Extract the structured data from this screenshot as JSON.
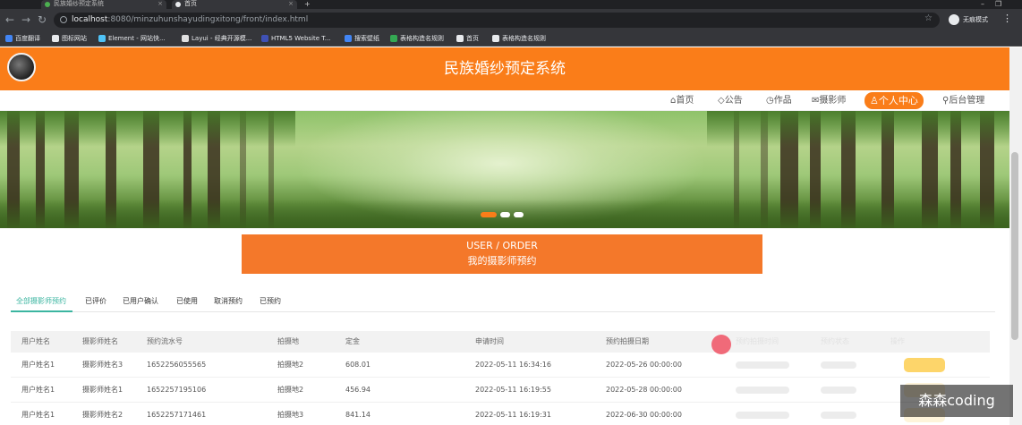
{
  "browser": {
    "tabs": [
      {
        "label": "民族婚纱预定系统"
      },
      {
        "label": "首页"
      }
    ],
    "new_tab": "+",
    "url_host": "localhost",
    "url_rest": ":8080/minzuhunshayudingxitong/front/index.html",
    "profile_label": "无痕模式",
    "bookmarks": [
      "百度翻译",
      "图标网站",
      "Element - 网站快...",
      "Layui - 经典开源模...",
      "HTML5 Website T...",
      "搜索壁纸",
      "表格构造名规则",
      "首页",
      "表格构造名规则"
    ],
    "bookmark_colors": [
      "#4285f4",
      "#e8eaed",
      "#4fc3f7",
      "#e0e0e0",
      "#3f51b5",
      "#4285f4",
      "#34a853",
      "#e8eaed",
      "#e8eaed"
    ]
  },
  "header": {
    "title": "民族婚纱预定系统",
    "accent": "#fa7d19"
  },
  "menu": [
    {
      "label": "首页",
      "icon": "home-icon",
      "glyph": "⌂"
    },
    {
      "label": "公告",
      "icon": "tag-icon",
      "glyph": "◇"
    },
    {
      "label": "作品",
      "icon": "clock-icon",
      "glyph": "◷"
    },
    {
      "label": "摄影师",
      "icon": "mail-icon",
      "glyph": "✉"
    },
    {
      "label": "个人中心",
      "icon": "user-icon",
      "glyph": "♙"
    },
    {
      "label": "后台管理",
      "icon": "link-icon",
      "glyph": "⚲"
    }
  ],
  "carousel": {
    "slides": 3,
    "active": 1
  },
  "order_box": {
    "title_en": "USER / ORDER",
    "title_cn": "我的摄影师预约"
  },
  "tabs": [
    "全部摄影师预约",
    "已评价",
    "已用户确认",
    "已使用",
    "取消预约",
    "已预约"
  ],
  "table": {
    "columns": [
      "用户姓名",
      "摄影师姓名",
      "预约流水号",
      "拍摄地",
      "定金",
      "申请时间",
      "预约拍摄日期",
      "预约拍摄时间",
      "预约状态",
      "操作"
    ],
    "rows": [
      [
        "用户姓名1",
        "摄影师姓名3",
        "1652256055565",
        "拍摄地2",
        "608.01",
        "2022-05-11 16:34:16",
        "2022-05-26 00:00:00"
      ],
      [
        "用户姓名1",
        "摄影师姓名1",
        "1652257195106",
        "拍摄地2",
        "456.94",
        "2022-05-11 16:19:55",
        "2022-05-28 00:00:00"
      ],
      [
        "用户姓名1",
        "摄影师姓名2",
        "1652257171461",
        "拍摄地3",
        "841.14",
        "2022-05-11 16:19:31",
        "2022-06-30 00:00:00"
      ]
    ]
  },
  "watermark": "森森coding"
}
